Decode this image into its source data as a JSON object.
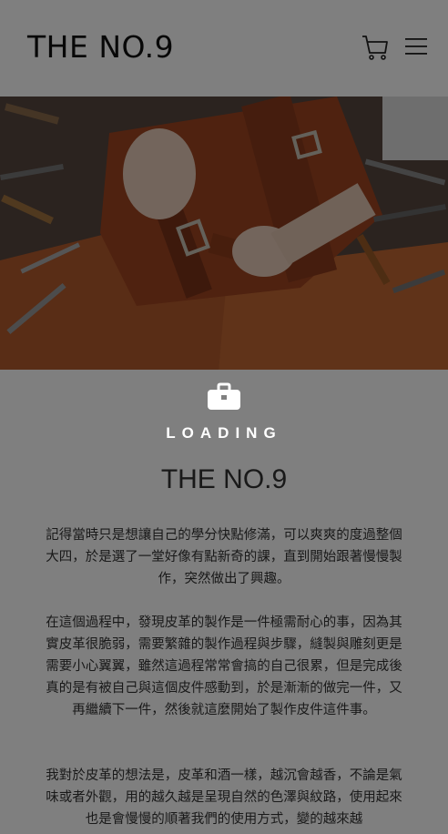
{
  "header": {
    "logo": "THE NO.9",
    "cart_icon": "cart-icon",
    "menu_icon": "hamburger-menu-icon"
  },
  "hero": {
    "image": "leather-craft-workbench-photo"
  },
  "loader": {
    "icon": "bag-icon",
    "text": "LOADING"
  },
  "content": {
    "title": "THE NO.9",
    "paragraphs": [
      "記得當時只是想讓自己的學分快點修滿，可以爽爽的度過整個大四，於是選了一堂好像有點新奇的課，直到開始跟著慢慢製作，突然做出了興趣。",
      "在這個過程中，發現皮革的製作是一件極需耐心的事，因為其實皮革很脆弱，需要繁雜的製作過程與步驟，縫製與雕刻更是需要小心翼翼，雖然這過程常常會搞的自己很累，但是完成後真的是有被自己與這個皮件感動到，於是漸漸的做完一件，又再繼續下一件，然後就這麼開始了製作皮件這件事。",
      "我對於皮革的想法是，皮革和酒一樣，越沉會越香，不論是氣味或者外觀，用的越久越是呈現自然的色澤與紋路，使用起來也是會慢慢的順著我們的使用方式，變的越來越"
    ]
  },
  "colors": {
    "overlay": "#000000",
    "leather": "#b5542a",
    "text": "#333333"
  }
}
